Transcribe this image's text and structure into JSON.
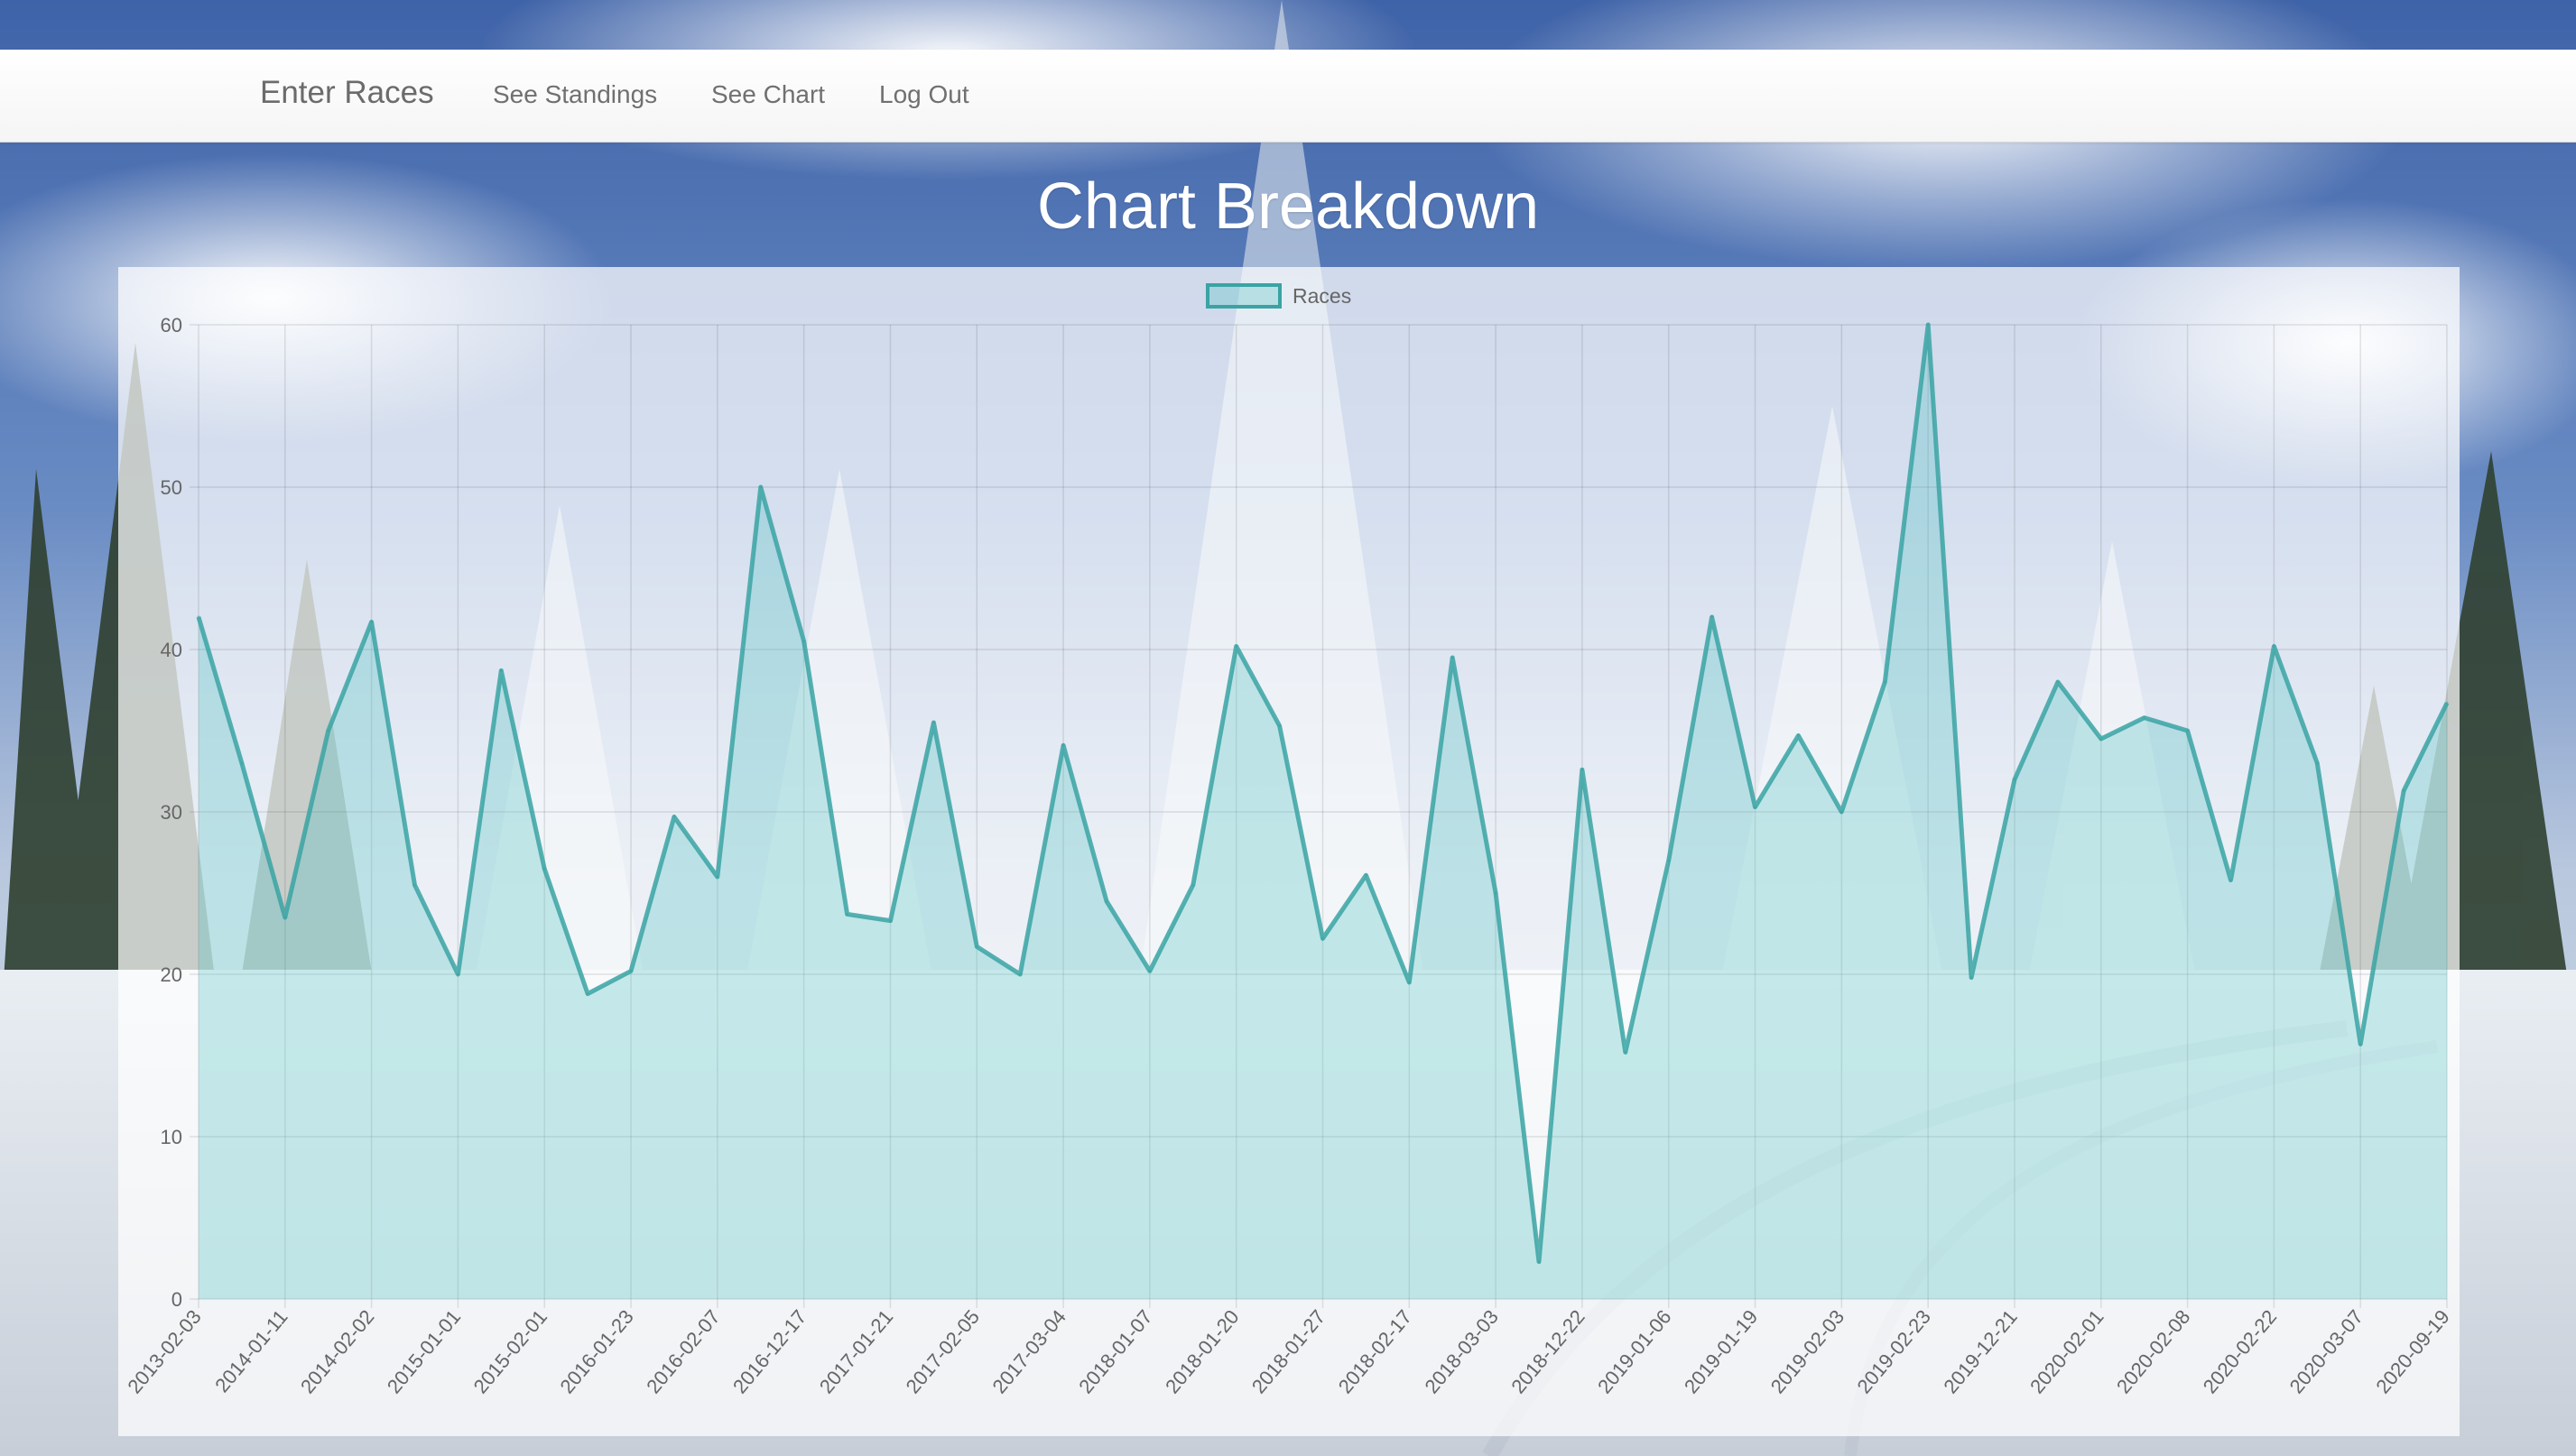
{
  "navbar": {
    "brand": "Enter Races",
    "links": [
      "See Standings",
      "See Chart",
      "Log Out"
    ]
  },
  "page": {
    "title": "Chart Breakdown"
  },
  "colors": {
    "line": "#3aa3a3",
    "fill": "rgba(75,192,192,0.30)",
    "grid": "rgba(0,0,0,0.10)"
  },
  "chart_data": {
    "type": "area",
    "title": "",
    "xlabel": "",
    "ylabel": "",
    "ylim": [
      0,
      60
    ],
    "yticks": [
      0,
      10,
      20,
      30,
      40,
      50,
      60
    ],
    "grid": true,
    "legend": "top-center",
    "tick_labels": [
      "2013-02-03",
      "2014-01-11",
      "2014-02-02",
      "2015-01-01",
      "2015-02-01",
      "2016-01-23",
      "2016-02-07",
      "2016-12-17",
      "2017-01-21",
      "2017-02-05",
      "2017-03-04",
      "2018-01-07",
      "2018-01-20",
      "2018-01-27",
      "2018-02-17",
      "2018-03-03",
      "2018-12-22",
      "2019-01-06",
      "2019-01-19",
      "2019-02-03",
      "2019-02-23",
      "2019-12-21",
      "2020-02-01",
      "2020-02-08",
      "2020-02-22",
      "2020-03-07",
      "2020-09-19"
    ],
    "series": [
      {
        "name": "Races",
        "values": [
          42,
          33,
          23.5,
          35,
          41.7,
          25.5,
          20,
          38.7,
          26.5,
          18.8,
          20.2,
          29.7,
          26,
          50,
          40.5,
          23.7,
          23.3,
          35.5,
          21.7,
          20,
          34.1,
          24.5,
          20.2,
          25.5,
          40.2,
          35.3,
          22.2,
          26.1,
          19.5,
          39.5,
          25,
          2.3,
          32.6,
          15.2,
          27,
          42,
          30.3,
          34.7,
          30,
          38,
          60,
          19.8,
          32,
          38,
          34.5,
          35.8,
          35,
          25.8,
          40.2,
          33,
          15.7,
          31.3,
          36.7
        ]
      }
    ]
  }
}
